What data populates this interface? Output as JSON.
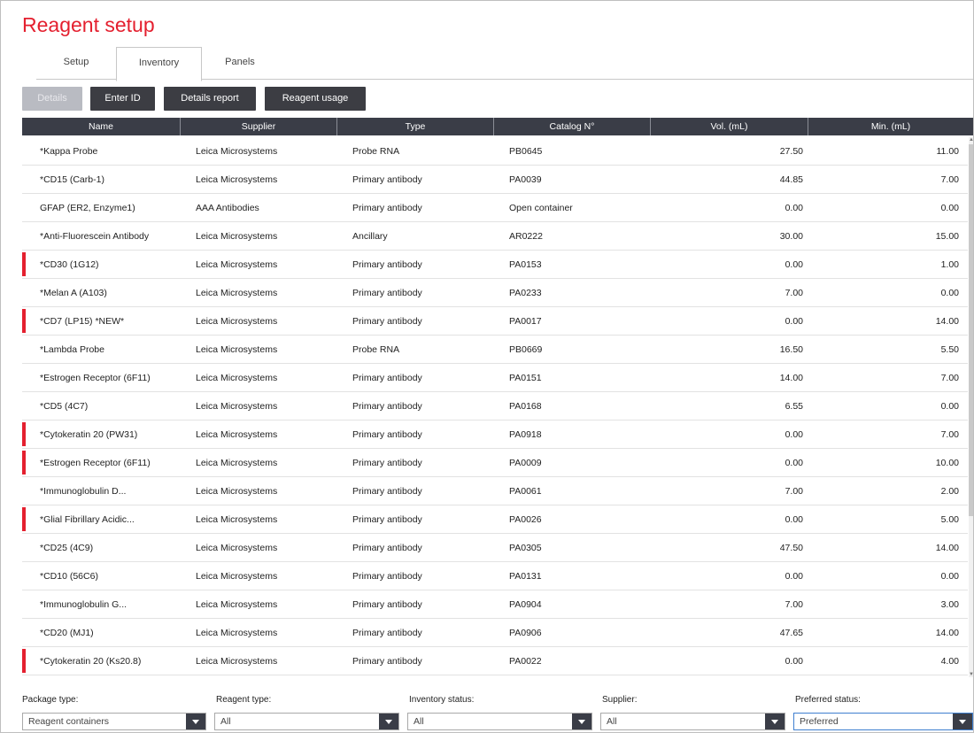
{
  "title": "Reagent setup",
  "tabs": [
    {
      "label": "Setup"
    },
    {
      "label": "Inventory"
    },
    {
      "label": "Panels"
    }
  ],
  "toolbar": {
    "details": "Details",
    "enter_id": "Enter ID",
    "details_report": "Details report",
    "reagent_usage": "Reagent usage"
  },
  "columns": [
    "Name",
    "Supplier",
    "Type",
    "Catalog N°",
    "Vol. (mL)",
    "Min. (mL)"
  ],
  "rows": [
    {
      "name": "*Kappa Probe",
      "supplier": "Leica Microsystems",
      "type": "Probe RNA",
      "catalog": "PB0645",
      "vol": "27.50",
      "min": "11.00",
      "flag": false
    },
    {
      "name": "*CD15 (Carb-1)",
      "supplier": "Leica Microsystems",
      "type": "Primary antibody",
      "catalog": "PA0039",
      "vol": "44.85",
      "min": "7.00",
      "flag": false
    },
    {
      "name": "GFAP (ER2, Enzyme1)",
      "supplier": "AAA Antibodies",
      "type": "Primary antibody",
      "catalog": "Open container",
      "vol": "0.00",
      "min": "0.00",
      "flag": false
    },
    {
      "name": "*Anti-Fluorescein Antibody",
      "supplier": "Leica Microsystems",
      "type": "Ancillary",
      "catalog": "AR0222",
      "vol": "30.00",
      "min": "15.00",
      "flag": false
    },
    {
      "name": "*CD30 (1G12)",
      "supplier": "Leica Microsystems",
      "type": "Primary antibody",
      "catalog": "PA0153",
      "vol": "0.00",
      "min": "1.00",
      "flag": true
    },
    {
      "name": "*Melan A (A103)",
      "supplier": "Leica Microsystems",
      "type": "Primary antibody",
      "catalog": "PA0233",
      "vol": "7.00",
      "min": "0.00",
      "flag": false
    },
    {
      "name": "*CD7 (LP15) *NEW*",
      "supplier": "Leica Microsystems",
      "type": "Primary antibody",
      "catalog": "PA0017",
      "vol": "0.00",
      "min": "14.00",
      "flag": true
    },
    {
      "name": "*Lambda Probe",
      "supplier": "Leica Microsystems",
      "type": "Probe RNA",
      "catalog": "PB0669",
      "vol": "16.50",
      "min": "5.50",
      "flag": false
    },
    {
      "name": "*Estrogen Receptor (6F11)",
      "supplier": "Leica Microsystems",
      "type": "Primary antibody",
      "catalog": "PA0151",
      "vol": "14.00",
      "min": "7.00",
      "flag": false
    },
    {
      "name": "*CD5 (4C7)",
      "supplier": "Leica Microsystems",
      "type": "Primary antibody",
      "catalog": "PA0168",
      "vol": "6.55",
      "min": "0.00",
      "flag": false
    },
    {
      "name": "*Cytokeratin 20 (PW31)",
      "supplier": "Leica Microsystems",
      "type": "Primary antibody",
      "catalog": "PA0918",
      "vol": "0.00",
      "min": "7.00",
      "flag": true
    },
    {
      "name": "*Estrogen Receptor (6F11)",
      "supplier": "Leica Microsystems",
      "type": "Primary antibody",
      "catalog": "PA0009",
      "vol": "0.00",
      "min": "10.00",
      "flag": true
    },
    {
      "name": "*Immunoglobulin D...",
      "supplier": "Leica Microsystems",
      "type": "Primary antibody",
      "catalog": "PA0061",
      "vol": "7.00",
      "min": "2.00",
      "flag": false
    },
    {
      "name": "*Glial Fibrillary Acidic...",
      "supplier": "Leica Microsystems",
      "type": "Primary antibody",
      "catalog": "PA0026",
      "vol": "0.00",
      "min": "5.00",
      "flag": true
    },
    {
      "name": "*CD25 (4C9)",
      "supplier": "Leica Microsystems",
      "type": "Primary antibody",
      "catalog": "PA0305",
      "vol": "47.50",
      "min": "14.00",
      "flag": false
    },
    {
      "name": "*CD10 (56C6)",
      "supplier": "Leica Microsystems",
      "type": "Primary antibody",
      "catalog": "PA0131",
      "vol": "0.00",
      "min": "0.00",
      "flag": false
    },
    {
      "name": "*Immunoglobulin G...",
      "supplier": "Leica Microsystems",
      "type": "Primary antibody",
      "catalog": "PA0904",
      "vol": "7.00",
      "min": "3.00",
      "flag": false
    },
    {
      "name": "*CD20 (MJ1)",
      "supplier": "Leica Microsystems",
      "type": "Primary antibody",
      "catalog": "PA0906",
      "vol": "47.65",
      "min": "14.00",
      "flag": false
    },
    {
      "name": "*Cytokeratin 20 (Ks20.8)",
      "supplier": "Leica Microsystems",
      "type": "Primary antibody",
      "catalog": "PA0022",
      "vol": "0.00",
      "min": "4.00",
      "flag": true
    }
  ],
  "filters": [
    {
      "label": "Package type:",
      "value": "Reagent containers"
    },
    {
      "label": "Reagent type:",
      "value": "All"
    },
    {
      "label": "Inventory status:",
      "value": "All"
    },
    {
      "label": "Supplier:",
      "value": "All"
    },
    {
      "label": "Preferred status:",
      "value": "Preferred"
    }
  ],
  "colors": {
    "accent": "#e4202f",
    "header_bg": "#3a3d47",
    "button_bg": "#3c3d43",
    "disabled_button_bg": "#b9bbc2"
  }
}
